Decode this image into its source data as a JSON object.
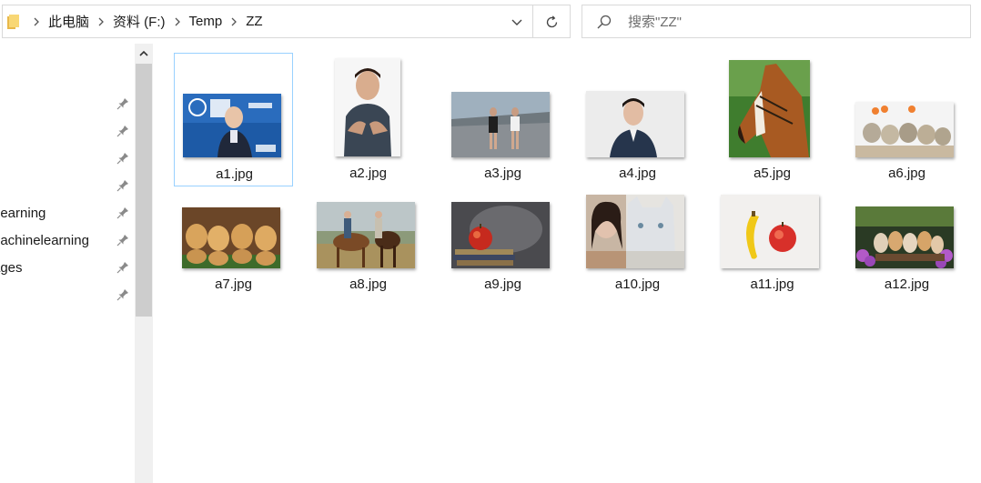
{
  "address_bar": {
    "breadcrumbs": [
      "此电脑",
      "资料 (F:)",
      "Temp",
      "ZZ"
    ]
  },
  "search": {
    "placeholder": "搜索\"ZZ\""
  },
  "nav_pane": {
    "items": [
      {
        "label": ""
      },
      {
        "label": ""
      },
      {
        "label": ""
      },
      {
        "label": ""
      },
      {
        "label": "Learning"
      },
      {
        "label": "nachinelearning"
      },
      {
        "label": "ages"
      },
      {
        "label": ""
      }
    ]
  },
  "files": [
    {
      "name": "a1.jpg",
      "thumb": "lecturer-photo",
      "selected": true
    },
    {
      "name": "a2.jpg",
      "thumb": "man-portrait-photo"
    },
    {
      "name": "a3.jpg",
      "thumb": "two-women-walking-photo"
    },
    {
      "name": "a4.jpg",
      "thumb": "man-in-suit-photo"
    },
    {
      "name": "a5.jpg",
      "thumb": "horse-head-photo"
    },
    {
      "name": "a6.jpg",
      "thumb": "kittens-photo"
    },
    {
      "name": "a7.jpg",
      "thumb": "puppies-photo"
    },
    {
      "name": "a8.jpg",
      "thumb": "couple-with-horses-photo"
    },
    {
      "name": "a9.jpg",
      "thumb": "apple-on-books-photo"
    },
    {
      "name": "a10.jpg",
      "thumb": "woman-with-cat-photo"
    },
    {
      "name": "a11.jpg",
      "thumb": "banana-and-apple-photo"
    },
    {
      "name": "a12.jpg",
      "thumb": "kittens-with-flowers-photo"
    }
  ],
  "colors": {
    "selection_border": "#99d1ff",
    "border": "#d9d9d9",
    "scroll_thumb": "#cdcdcd"
  }
}
